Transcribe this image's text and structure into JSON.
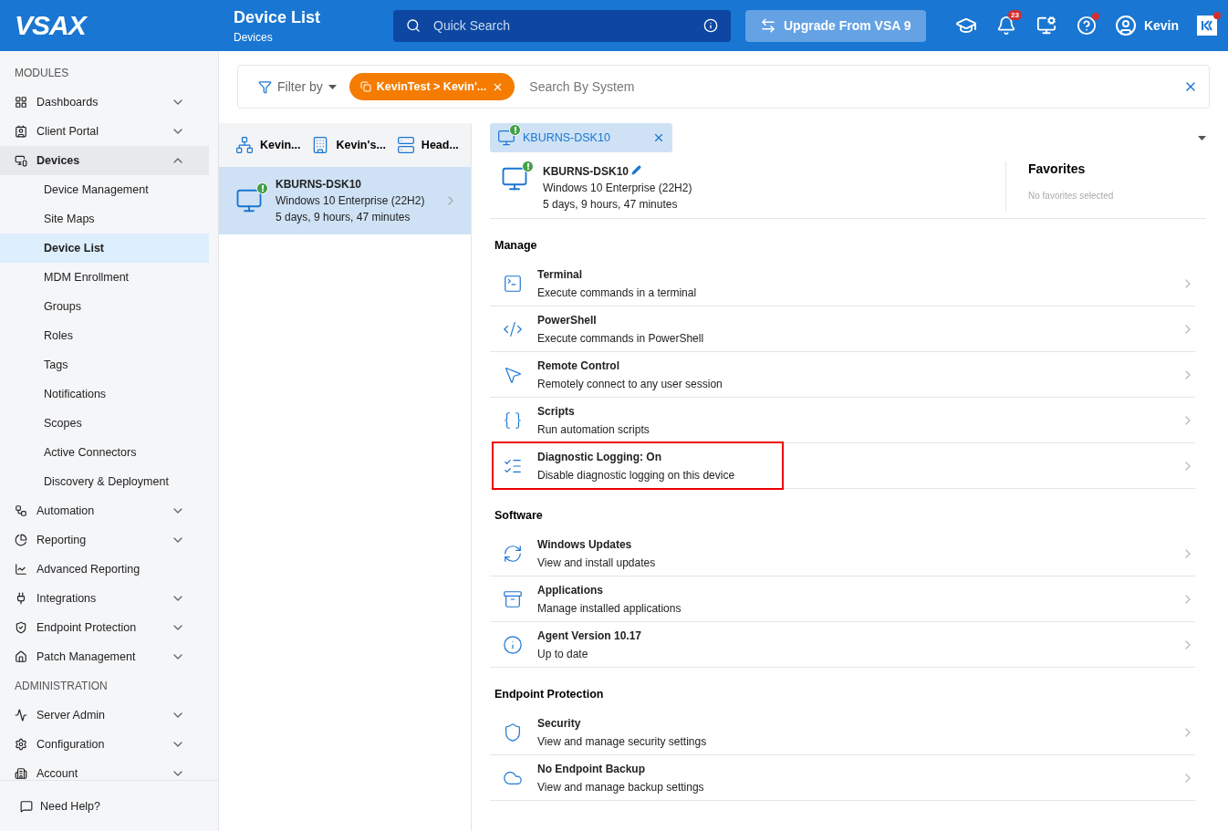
{
  "header": {
    "logo": "VSAX",
    "title": "Device List",
    "subtitle": "Devices",
    "search": {
      "placeholder": "Quick Search"
    },
    "upgrade_button": "Upgrade From VSA 9",
    "notification_count": "23",
    "help_alert": true,
    "user": "Kevin",
    "app_alert": true
  },
  "sidebar": {
    "sections": [
      {
        "title": "MODULES",
        "items": [
          {
            "label": "Dashboards",
            "expanded": false,
            "has_children": true,
            "selected": false
          },
          {
            "label": "Client Portal",
            "expanded": false,
            "has_children": true,
            "selected": false
          },
          {
            "label": "Devices",
            "expanded": true,
            "has_children": true,
            "selected": true,
            "children": [
              {
                "label": "Device Management",
                "selected": false
              },
              {
                "label": "Site Maps",
                "selected": false
              },
              {
                "label": "Device List",
                "selected": true
              },
              {
                "label": "MDM Enrollment",
                "selected": false
              },
              {
                "label": "Groups",
                "selected": false
              },
              {
                "label": "Roles",
                "selected": false
              },
              {
                "label": "Tags",
                "selected": false
              },
              {
                "label": "Notifications",
                "selected": false
              },
              {
                "label": "Scopes",
                "selected": false
              },
              {
                "label": "Active Connectors",
                "selected": false
              },
              {
                "label": "Discovery & Deployment",
                "selected": false
              }
            ]
          },
          {
            "label": "Automation",
            "expanded": false,
            "has_children": true,
            "selected": false
          },
          {
            "label": "Reporting",
            "expanded": false,
            "has_children": true,
            "selected": false
          },
          {
            "label": "Advanced Reporting",
            "has_children": false,
            "selected": false
          },
          {
            "label": "Integrations",
            "expanded": false,
            "has_children": true,
            "selected": false
          },
          {
            "label": "Endpoint Protection",
            "expanded": false,
            "has_children": true,
            "selected": false
          },
          {
            "label": "Patch Management",
            "expanded": false,
            "has_children": true,
            "selected": false
          }
        ]
      },
      {
        "title": "ADMINISTRATION",
        "items": [
          {
            "label": "Server Admin",
            "expanded": false,
            "has_children": true,
            "selected": false
          },
          {
            "label": "Configuration",
            "expanded": false,
            "has_children": true,
            "selected": false
          },
          {
            "label": "Account",
            "expanded": false,
            "has_children": true,
            "selected": false
          }
        ]
      }
    ],
    "help": "Need Help?"
  },
  "filter_bar": {
    "filter_label": "Filter by",
    "chip": "KevinTest > Kevin'...",
    "search_placeholder": "Search By System"
  },
  "breadcrumb": [
    "Kevin...",
    "Kevin's...",
    "Head..."
  ],
  "device_list": [
    {
      "name": "KBURNS-DSK10",
      "os": "Windows 10 Enterprise (22H2)",
      "uptime": "5 days, 9 hours, 47 minutes",
      "alert": true,
      "selected": true
    }
  ],
  "detail": {
    "tab": {
      "label": "KBURNS-DSK10",
      "alert": true
    },
    "device": {
      "name": "KBURNS-DSK10",
      "os": "Windows 10 Enterprise (22H2)",
      "uptime": "5 days, 9 hours, 47 minutes",
      "alert": true
    },
    "favorites": {
      "title": "Favorites",
      "empty": "No favorites selected"
    },
    "sections": [
      {
        "title": "Manage",
        "items": [
          {
            "title": "Terminal",
            "subtitle": "Execute commands in a terminal",
            "highlighted": false
          },
          {
            "title": "PowerShell",
            "subtitle": "Execute commands in PowerShell",
            "highlighted": false
          },
          {
            "title": "Remote Control",
            "subtitle": "Remotely connect to any user session",
            "highlighted": false
          },
          {
            "title": "Scripts",
            "subtitle": "Run automation scripts",
            "highlighted": false
          },
          {
            "title": "Diagnostic Logging: On",
            "subtitle": "Disable diagnostic logging on this device",
            "highlighted": true
          }
        ]
      },
      {
        "title": "Software",
        "items": [
          {
            "title": "Windows Updates",
            "subtitle": "View and install updates",
            "highlighted": false
          },
          {
            "title": "Applications",
            "subtitle": "Manage installed applications",
            "highlighted": false
          },
          {
            "title": "Agent Version 10.17",
            "subtitle": "Up to date",
            "highlighted": false
          }
        ]
      },
      {
        "title": "Endpoint Protection",
        "items": [
          {
            "title": "Security",
            "subtitle": "View and manage security settings",
            "highlighted": false
          },
          {
            "title": "No Endpoint Backup",
            "subtitle": "View and manage backup settings",
            "highlighted": false
          }
        ]
      }
    ]
  }
}
